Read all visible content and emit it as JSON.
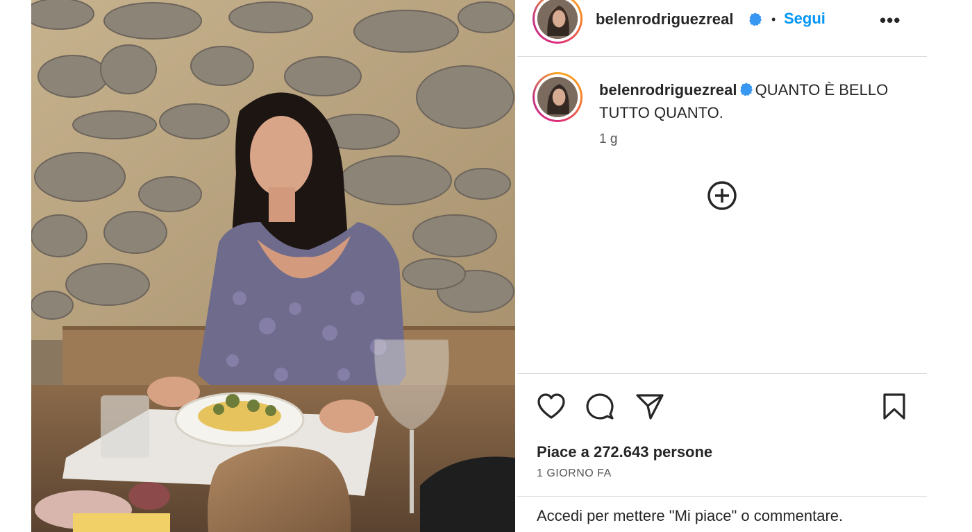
{
  "post": {
    "username": "belenrodriguezreal",
    "follow_label": "Segui",
    "separator": "•",
    "more_label": "•••",
    "caption": "QUANTO È BELLO TUTTO QUANTO.",
    "time_ago": "1 g",
    "likes_text": "Piace a 272.643 persone",
    "date_text": "1 GIORNO FA",
    "login_prompt": {
      "link_text": "Accedi",
      "rest_text": "per mettere \"Mi piace\" o commentare."
    }
  },
  "icons": {
    "verified": "verified-badge-icon",
    "more": "more-options-icon",
    "load_comments": "plus-circle-icon",
    "like": "heart-icon",
    "comment": "comment-icon",
    "share": "share-icon",
    "save": "bookmark-icon"
  },
  "colors": {
    "accent": "#0095f6",
    "verified": "#3897f0",
    "text": "#262626",
    "border": "#dbdbdb"
  }
}
